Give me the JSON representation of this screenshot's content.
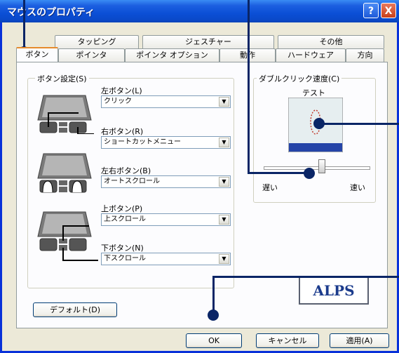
{
  "window": {
    "title": "マウスのプロパティ",
    "help_label": "?",
    "close_label": "X"
  },
  "tabs_back": [
    "タッピング",
    "ジェスチャー",
    "その他"
  ],
  "tabs_front": [
    "ボタン",
    "ポインタ",
    "ポインタ オプション",
    "動作",
    "ハードウェア",
    "方向"
  ],
  "button_settings": {
    "group_label": "ボタン設定(S)",
    "left": {
      "label": "左ボタン(L)",
      "value": "クリック"
    },
    "right": {
      "label": "右ボタン(R)",
      "value": "ショートカットメニュー"
    },
    "both": {
      "label": "左右ボタン(B)",
      "value": "オートスクロール"
    },
    "up": {
      "label": "上ボタン(P)",
      "value": "上スクロール"
    },
    "down": {
      "label": "下ボタン(N)",
      "value": "下スクロール"
    }
  },
  "dblclick": {
    "group_label": "ダブルクリック速度(C)",
    "test_label": "テスト",
    "slow_label": "遅い",
    "fast_label": "速い",
    "speed": 0.55
  },
  "default_button": "デフォルト(D)",
  "brand": "ALPS",
  "footer": {
    "ok": "OK",
    "cancel": "キャンセル",
    "apply": "適用(A)"
  },
  "colors": {
    "accent": "#0a2566",
    "title_bar": "#0b4fd6"
  }
}
